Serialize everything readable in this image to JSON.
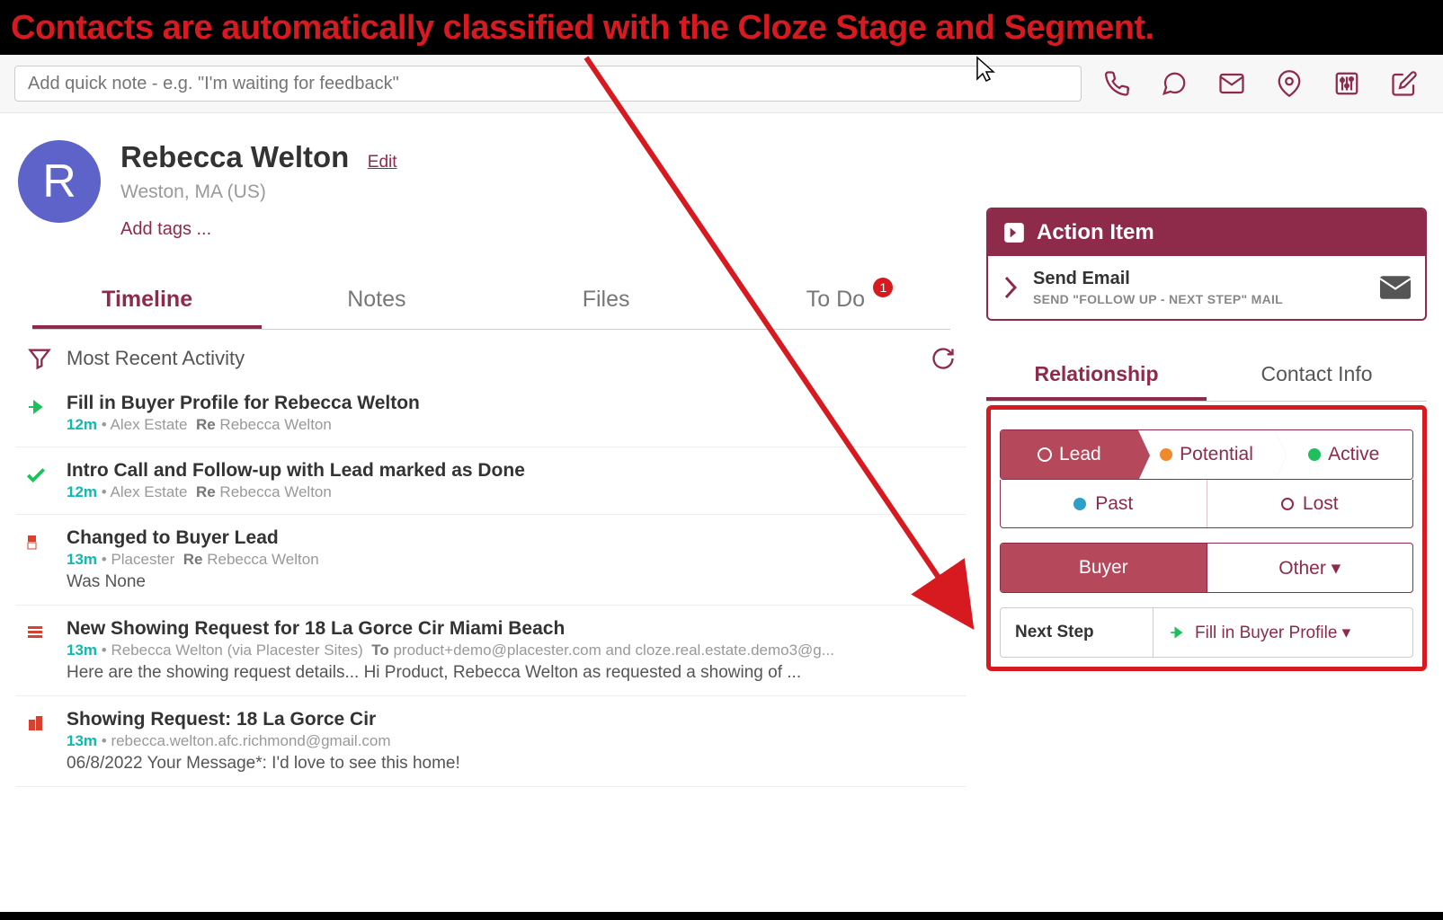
{
  "annotation": "Contacts are automatically classified with the Cloze Stage and Segment.",
  "quicknote_placeholder": "Add quick note - e.g. \"I'm waiting for feedback\"",
  "contact": {
    "initial": "R",
    "name": "Rebecca Welton",
    "edit": "Edit",
    "location": "Weston, MA (US)",
    "add_tags": "Add tags ..."
  },
  "tabs": {
    "timeline": "Timeline",
    "notes": "Notes",
    "files": "Files",
    "todo": "To Do",
    "todo_badge": "1"
  },
  "filter_label": "Most Recent Activity",
  "timeline": [
    {
      "icon": "arrow-green",
      "title": "Fill in Buyer Profile for Rebecca Welton",
      "time": "12m",
      "author": "Alex Estate",
      "re_label": "Re",
      "re": "Rebecca Welton"
    },
    {
      "icon": "check-green",
      "title": "Intro Call and Follow-up with Lead marked as Done",
      "time": "12m",
      "author": "Alex Estate",
      "re_label": "Re",
      "re": "Rebecca Welton"
    },
    {
      "icon": "tag-red",
      "title": "Changed to Buyer Lead",
      "time": "13m",
      "author": "Placester",
      "re_label": "Re",
      "re": "Rebecca Welton",
      "extra": "Was None"
    },
    {
      "icon": "stack-red",
      "title": "New Showing Request for 18 La Gorce Cir Miami Beach",
      "time": "13m",
      "author": "Rebecca Welton (via Placester Sites)",
      "to_label": "To",
      "to": "product+demo@placester.com and cloze.real.estate.demo3@g...",
      "extra": "Here are the showing request details... Hi Product, Rebecca Welton as requested a showing of ..."
    },
    {
      "icon": "door-red",
      "title": "Showing Request: 18 La Gorce Cir",
      "time": "13m",
      "author": "rebecca.welton.afc.richmond@gmail.com",
      "extra": "06/8/2022 Your Message*: I'd love to see this home!"
    }
  ],
  "action": {
    "header": "Action Item",
    "title": "Send Email",
    "sub": "SEND \"FOLLOW UP - NEXT STEP\" MAIL"
  },
  "rel_tabs": {
    "relationship": "Relationship",
    "contactinfo": "Contact Info"
  },
  "stages": {
    "lead": "Lead",
    "potential": "Potential",
    "active": "Active",
    "past": "Past",
    "lost": "Lost"
  },
  "segments": {
    "buyer": "Buyer",
    "other": "Other ▾"
  },
  "nextstep": {
    "label": "Next Step",
    "value": "Fill in Buyer Profile ▾"
  }
}
